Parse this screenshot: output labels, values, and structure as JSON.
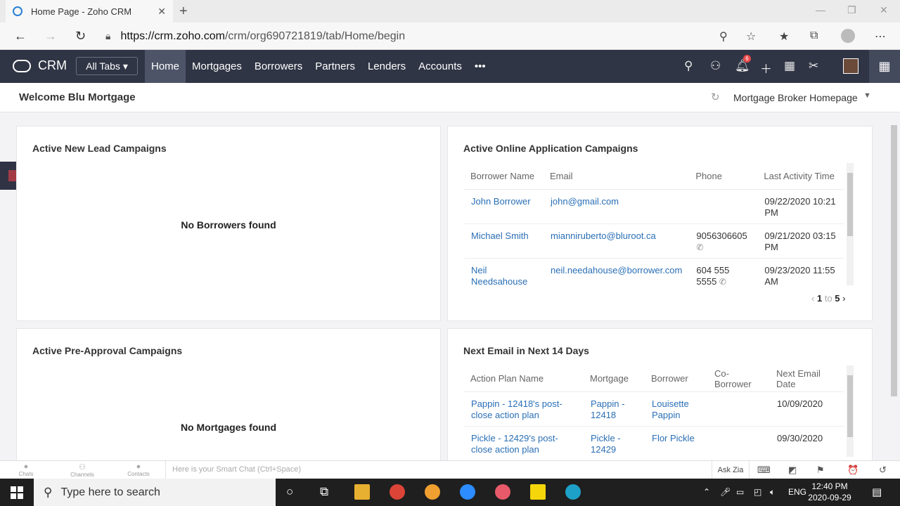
{
  "browser": {
    "tab_title": "Home Page - Zoho CRM",
    "tab_close": "✕",
    "new_tab": "+",
    "url_domain": "https://crm.zoho.com",
    "url_path": "/crm/org690721819/tab/Home/begin"
  },
  "crm": {
    "logo_text": "CRM",
    "all_tabs_label": "All Tabs ▾",
    "nav_items": [
      "Home",
      "Mortgages",
      "Borrowers",
      "Partners",
      "Lenders",
      "Accounts"
    ],
    "more_label": "•••",
    "notification_count": "6"
  },
  "welcome": {
    "title": "Welcome Blu Mortgage",
    "homepage_select": "Mortgage Broker Homepage"
  },
  "cards": {
    "new_lead": {
      "title": "Active New Lead Campaigns",
      "empty_text": "No Borrowers found"
    },
    "online_app": {
      "title": "Active Online Application Campaigns",
      "columns": [
        "Borrower Name",
        "Email",
        "Phone",
        "Last Activity Time"
      ],
      "rows": [
        {
          "name": "John Borrower",
          "email": "john@gmail.com",
          "phone": "",
          "last": "09/22/2020 10:21 PM"
        },
        {
          "name": "Michael Smith",
          "email": "mianniruberto@bluroot.ca",
          "phone": "9056306605",
          "last": "09/21/2020 03:15 PM"
        },
        {
          "name": "Neil Needsahouse",
          "email": "neil.needahouse@borrower.com",
          "phone": "604 555 5555",
          "last": "09/23/2020 11:55 AM"
        }
      ],
      "pager_start": "1",
      "pager_to": "to",
      "pager_end": "5"
    },
    "pre_approval": {
      "title": "Active Pre-Approval Campaigns",
      "empty_text": "No Mortgages found"
    },
    "next_email": {
      "title": "Next Email in Next 14 Days",
      "columns": [
        "Action Plan Name",
        "Mortgage",
        "Borrower",
        "Co-Borrower",
        "Next Email Date"
      ],
      "rows": [
        {
          "plan": "Pappin - 12418's post-close action plan",
          "mortgage": "Pappin - 12418",
          "borrower": "Louisette Pappin",
          "coborrower": "",
          "date": "10/09/2020"
        },
        {
          "plan": "Pickle - 12429's post-close action plan",
          "mortgage": "Pickle - 12429",
          "borrower": "Flor Pickle",
          "coborrower": "",
          "date": "09/30/2020"
        }
      ]
    }
  },
  "chatbar": {
    "chats": "Chats",
    "channels": "Channels",
    "contacts": "Contacts",
    "smart_chat_placeholder": "Here is your Smart Chat (Ctrl+Space)",
    "ask_zia": "Ask Zia"
  },
  "taskbar": {
    "search_placeholder": "Type here to search",
    "lang": "ENG",
    "time": "12:40 PM",
    "date": "2020-09-29"
  }
}
